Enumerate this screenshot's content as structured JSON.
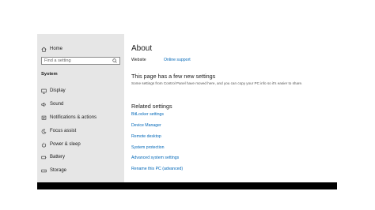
{
  "sidebar": {
    "home_label": "Home",
    "search_placeholder": "Find a setting",
    "section_title": "System",
    "items": [
      {
        "label": "Display",
        "icon": "display-icon"
      },
      {
        "label": "Sound",
        "icon": "speaker-icon"
      },
      {
        "label": "Notifications & actions",
        "icon": "notification-icon"
      },
      {
        "label": "Focus assist",
        "icon": "moon-icon"
      },
      {
        "label": "Power & sleep",
        "icon": "power-icon"
      },
      {
        "label": "Battery",
        "icon": "battery-icon"
      },
      {
        "label": "Storage",
        "icon": "storage-icon"
      }
    ]
  },
  "main": {
    "title": "About",
    "website_label": "Website",
    "website_link": "Online support",
    "new_settings_heading": "This page has a few new settings",
    "new_settings_desc": "Some settings from Control Panel have moved here, and you can copy your PC info so it's easier to share.",
    "related_heading": "Related settings",
    "related_links": [
      "BitLocker settings",
      "Device Manager",
      "Remote desktop",
      "System protection",
      "Advanced system settings",
      "Rename this PC (advanced)"
    ]
  },
  "colors": {
    "sidebar_bg": "#e6e6e6",
    "link": "#0067b8",
    "text": "#1a1a1a"
  }
}
